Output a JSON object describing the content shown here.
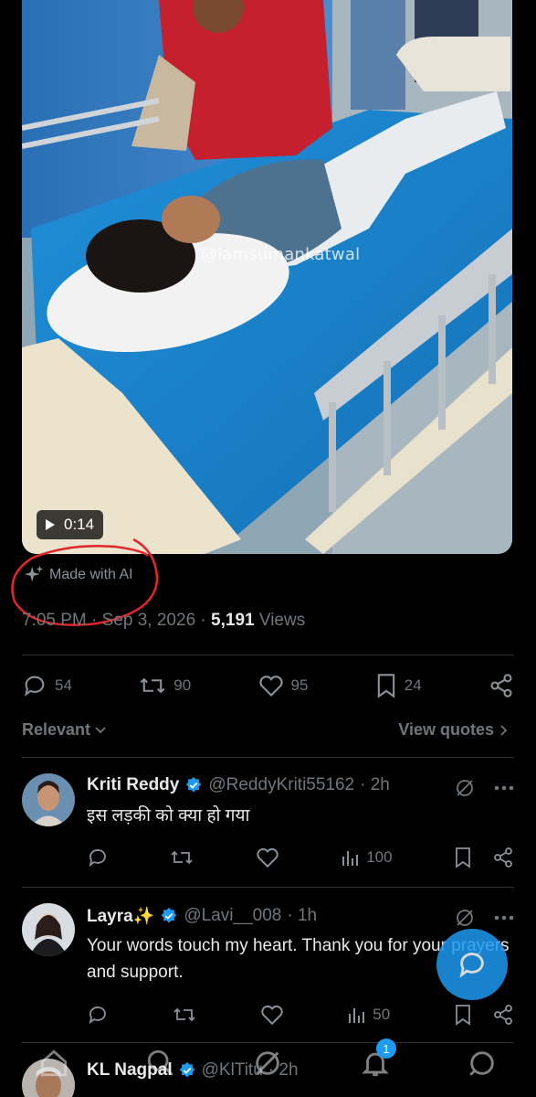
{
  "video": {
    "watermark": "@iamsumankatwal",
    "duration": "0:14"
  },
  "ai_label": {
    "text": "Made with AI",
    "icon": "sparkle-icon"
  },
  "tweet_meta": {
    "time": "7:05 PM",
    "date": "Sep 3, 2026",
    "views_count": "5,191",
    "views_label": "Views",
    "sep": "·"
  },
  "actions": {
    "replies": "54",
    "reposts": "90",
    "likes": "95",
    "bookmarks": "24"
  },
  "sort": {
    "relevant": "Relevant",
    "view_quotes": "View quotes"
  },
  "replies": [
    {
      "name": "Kriti Reddy",
      "handle": "@ReddyKriti55162",
      "time": "· 2h",
      "text": "इस लड़की को क्या हो गया",
      "views": "100"
    },
    {
      "name": "Layra✨",
      "handle": "@Lavi__008",
      "time": "· 1h",
      "text": "Your words touch my heart. Thank you for your prayers and support.",
      "views": "50"
    },
    {
      "name": "KL Nagpal",
      "handle": "@KlTitu",
      "time": "· 2h"
    }
  ],
  "nav": {
    "notification_count": "1"
  },
  "colors": {
    "accent": "#1d9bf0",
    "annotation": "#e0262a",
    "muted": "#71767b"
  }
}
